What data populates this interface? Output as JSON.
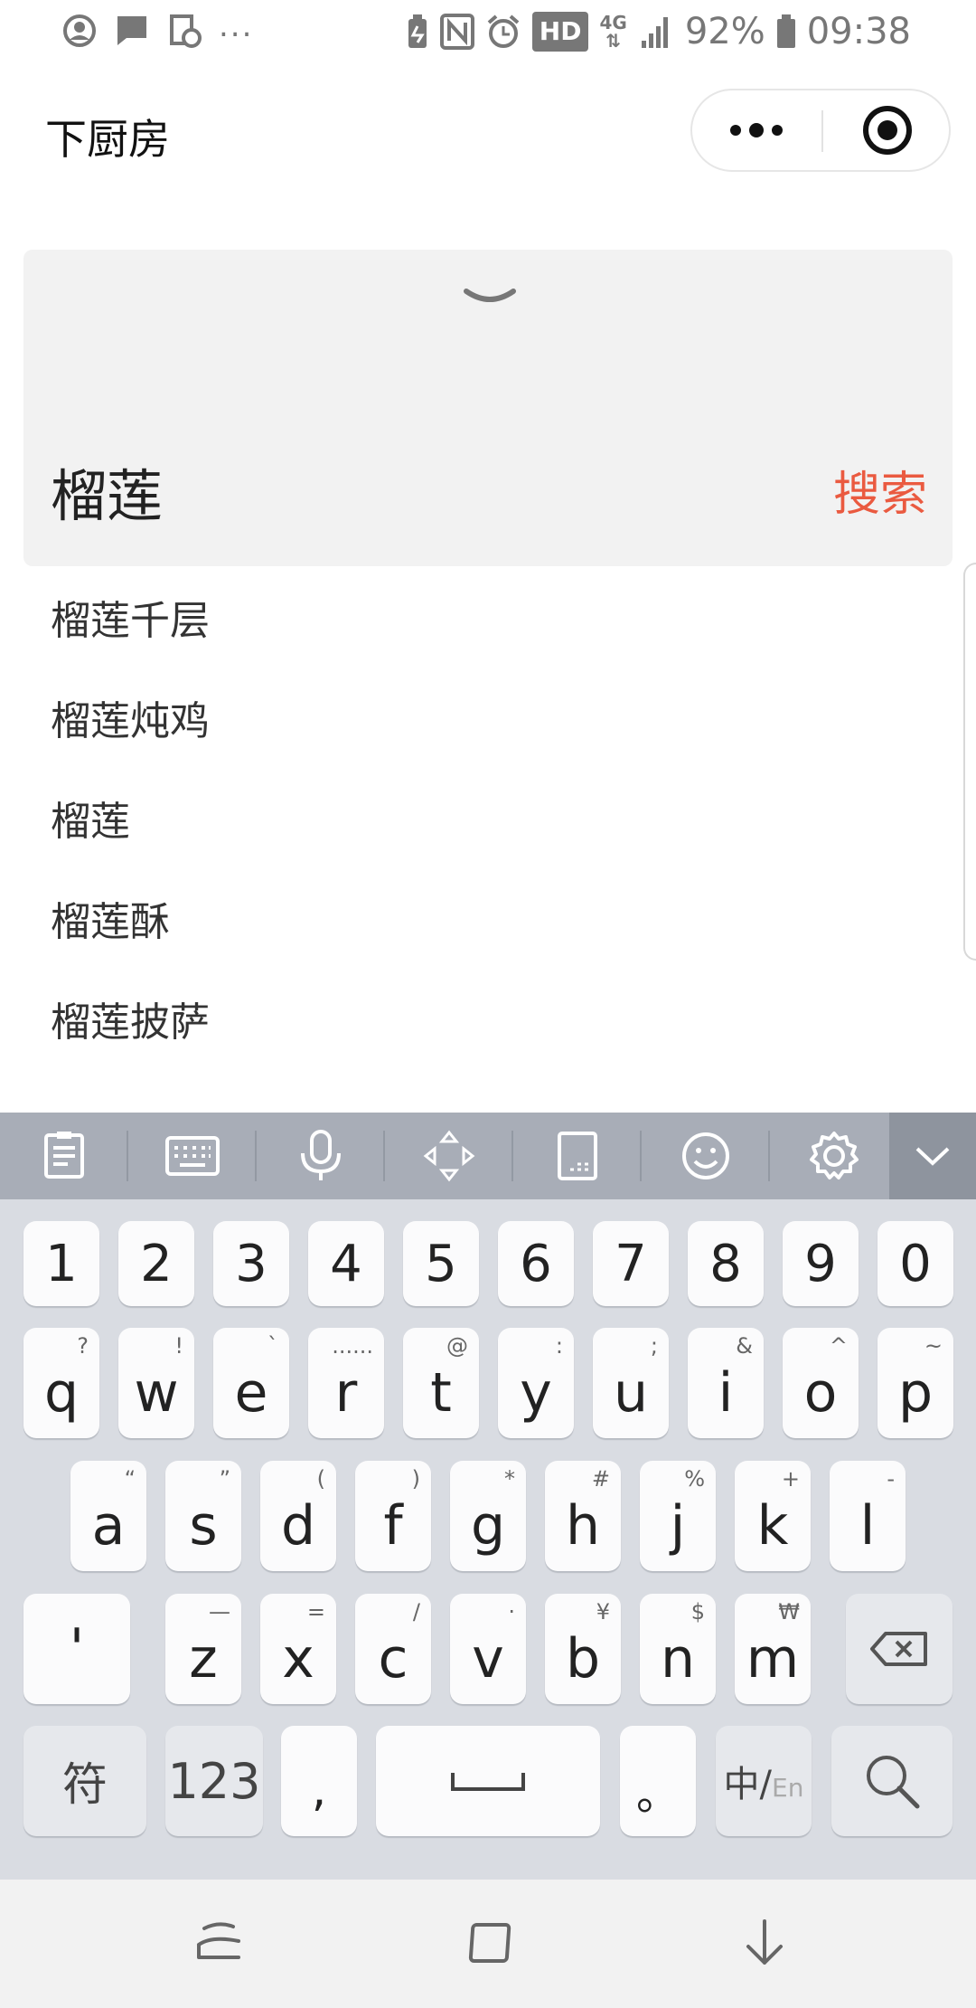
{
  "status_bar": {
    "left_icons": [
      "account-circle-icon",
      "message-icon",
      "screenshot-icon"
    ],
    "overflow": "...",
    "hd_label": "HD",
    "network": "4G",
    "battery": "92%",
    "time": "09:38"
  },
  "header": {
    "title": "下厨房",
    "more_icon": "more-dots-icon",
    "close_icon": "target-close-icon"
  },
  "search": {
    "query": "榴莲",
    "button_label": "搜索",
    "accent_color": "#ea5a40"
  },
  "suggestions": [
    "榴莲千层",
    "榴莲炖鸡",
    "榴莲",
    "榴莲酥",
    "榴莲披萨"
  ],
  "keyboard_toolbar": {
    "items": [
      "clipboard-icon",
      "keyboard-icon",
      "microphone-icon",
      "move-cursor-icon",
      "one-hand-icon",
      "emoji-icon",
      "settings-icon",
      "hide-keyboard-icon"
    ]
  },
  "keyboard": {
    "numbers": [
      "1",
      "2",
      "3",
      "4",
      "5",
      "6",
      "7",
      "8",
      "9",
      "0"
    ],
    "row1": [
      {
        "key": "q",
        "hint": "?"
      },
      {
        "key": "w",
        "hint": "!"
      },
      {
        "key": "e",
        "hint": "`"
      },
      {
        "key": "r",
        "hint": "......"
      },
      {
        "key": "t",
        "hint": "@"
      },
      {
        "key": "y",
        "hint": ":"
      },
      {
        "key": "u",
        "hint": ";"
      },
      {
        "key": "i",
        "hint": "&"
      },
      {
        "key": "o",
        "hint": "^"
      },
      {
        "key": "p",
        "hint": "~"
      }
    ],
    "row2": [
      {
        "key": "a",
        "hint": "“"
      },
      {
        "key": "s",
        "hint": "”"
      },
      {
        "key": "d",
        "hint": "("
      },
      {
        "key": "f",
        "hint": ")"
      },
      {
        "key": "g",
        "hint": "*"
      },
      {
        "key": "h",
        "hint": "#"
      },
      {
        "key": "j",
        "hint": "%"
      },
      {
        "key": "k",
        "hint": "+"
      },
      {
        "key": "l",
        "hint": "-"
      }
    ],
    "row3": [
      {
        "key": "z",
        "hint": "—"
      },
      {
        "key": "x",
        "hint": "="
      },
      {
        "key": "c",
        "hint": "/"
      },
      {
        "key": "v",
        "hint": "·"
      },
      {
        "key": "b",
        "hint": "¥"
      },
      {
        "key": "n",
        "hint": "$"
      },
      {
        "key": "m",
        "hint": "₩"
      }
    ],
    "apostrophe": "'",
    "symbols_label": "符",
    "numeric_label": "123",
    "comma": ",",
    "period": "。",
    "lang_main": "中/",
    "lang_sub": "En"
  },
  "nav_bar": {
    "items": [
      "recent-apps-icon",
      "home-icon",
      "back-icon"
    ]
  }
}
